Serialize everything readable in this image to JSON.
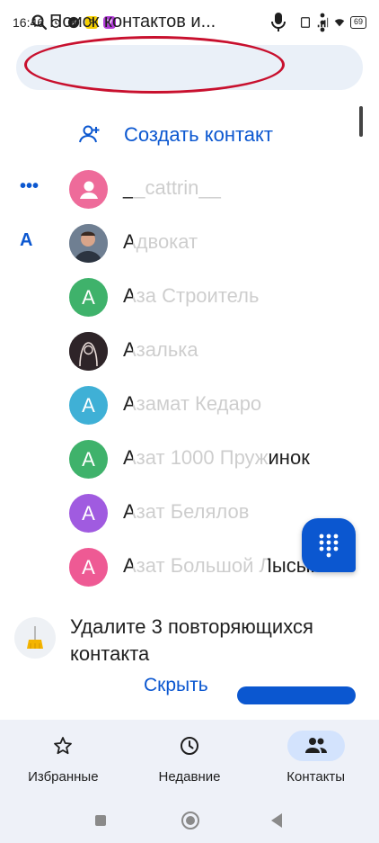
{
  "status_bar": {
    "time": "16:46",
    "battery": "69",
    "app_badge_y": "Я",
    "app_badge_v": "V"
  },
  "search": {
    "placeholder": "Поиск контактов и..."
  },
  "create_contact": {
    "label": "Создать контакт"
  },
  "contacts": [
    {
      "section": "•••",
      "name": "__cattrin__",
      "avatar_type": "person-icon",
      "avatar_letter": "",
      "avatar_color": "#ee6b9a"
    },
    {
      "section": "А",
      "name": "Адвокат",
      "avatar_type": "photo",
      "avatar_letter": "",
      "avatar_color": "#6b7a8c"
    },
    {
      "section": "",
      "name": "Аза Строитель",
      "avatar_type": "letter",
      "avatar_letter": "А",
      "avatar_color": "#3fb26b"
    },
    {
      "section": "",
      "name": "Азалька",
      "avatar_type": "photo",
      "avatar_letter": "",
      "avatar_color": "#2e2428"
    },
    {
      "section": "",
      "name": "Азамат Кедаро",
      "avatar_type": "letter",
      "avatar_letter": "А",
      "avatar_color": "#3fb0d6"
    },
    {
      "section": "",
      "name": "Азат 1000 Пружинок",
      "avatar_type": "letter",
      "avatar_letter": "А",
      "avatar_color": "#3fb26b"
    },
    {
      "section": "",
      "name": "Азат Белялов",
      "avatar_type": "letter",
      "avatar_letter": "А",
      "avatar_color": "#a05be0"
    },
    {
      "section": "",
      "name": "Азат Большой Лысый",
      "avatar_type": "letter",
      "avatar_letter": "А",
      "avatar_color": "#ee5a94"
    }
  ],
  "duplicates_card": {
    "message": "Удалите 3 повторяющихся контакта",
    "hide_label": "Скрыть"
  },
  "bottom_nav": {
    "favorites_label": "Избранные",
    "recent_label": "Недавние",
    "contacts_label": "Контакты",
    "active": "contacts"
  },
  "colors": {
    "accent": "#0b57d0",
    "annotation": "#c8102e"
  }
}
